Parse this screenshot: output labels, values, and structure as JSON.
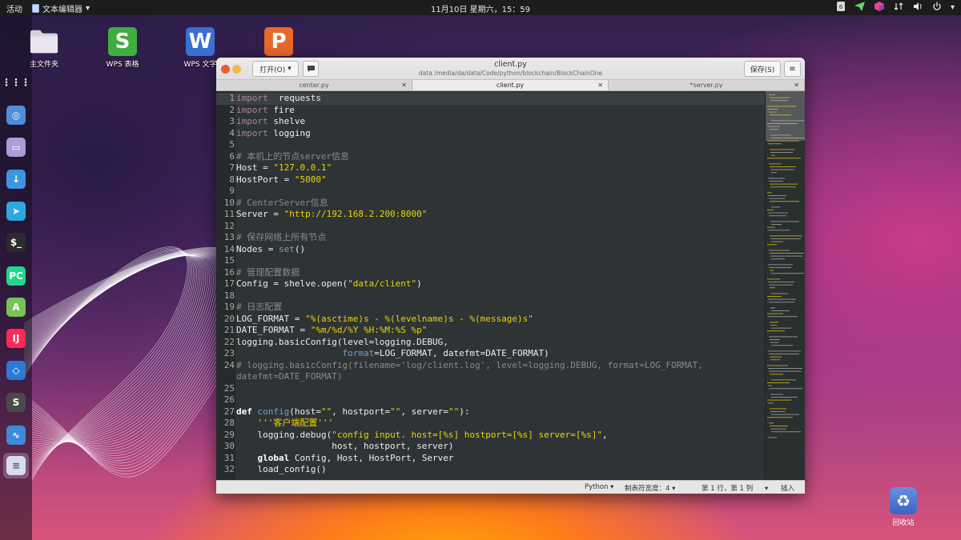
{
  "topbar": {
    "activities": "活动",
    "app_menu": "文本编辑器",
    "app_menu_arrow": "▾",
    "clock": "11月10日 星期六，15：59",
    "tray_icons": [
      "app-indicator-icon",
      "send-icon",
      "cube-icon",
      "network-icon",
      "volume-icon",
      "power-icon"
    ],
    "tray_arrow": "▾"
  },
  "desktop": {
    "icons": [
      {
        "label": "主文件夹",
        "icon": "folder-icon"
      },
      {
        "label": "WPS 表格",
        "icon": "wps-spreadsheet-icon",
        "glyph": "S",
        "color": "#3fae3f"
      },
      {
        "label": "WPS 文字",
        "icon": "wps-writer-icon",
        "glyph": "W",
        "color": "#3b6fd1"
      },
      {
        "label": "",
        "icon": "wps-presentation-icon",
        "glyph": "P",
        "color": "#e8682a"
      }
    ],
    "trash_label": "回收站"
  },
  "dock": {
    "items": [
      {
        "name": "app-grid",
        "glyph": "⋮⋮⋮",
        "color": "#ffffff"
      },
      {
        "name": "chromium",
        "glyph": "◎",
        "color": "#4a8fd8"
      },
      {
        "name": "files",
        "glyph": "▭",
        "color": "#b09ad8"
      },
      {
        "name": "downloader",
        "glyph": "↓",
        "color": "#3d95e0"
      },
      {
        "name": "telegram",
        "glyph": "➤",
        "color": "#2ea6df"
      },
      {
        "name": "terminal",
        "glyph": "$_",
        "color": "#2b2b2b"
      },
      {
        "name": "pycharm",
        "glyph": "PC",
        "color": "#21d789"
      },
      {
        "name": "android-studio",
        "glyph": "A",
        "color": "#78c257"
      },
      {
        "name": "intellij",
        "glyph": "IJ",
        "color": "#fe2857"
      },
      {
        "name": "vscode",
        "glyph": "◇",
        "color": "#2b7bd6"
      },
      {
        "name": "sublime",
        "glyph": "S",
        "color": "#4a4a4a"
      },
      {
        "name": "system-monitor",
        "glyph": "∿",
        "color": "#3d8bd9"
      },
      {
        "name": "text-editor",
        "glyph": "≡",
        "color": "#d8dcf0"
      }
    ]
  },
  "window": {
    "open_label": "打开(O)",
    "open_arrow": "▾",
    "title": "client.py",
    "path": "data /media/da/data/Code/python/blockchain/BlockChainOne",
    "save_label": "保存(S)",
    "menu_glyph": "≡",
    "tabs": [
      {
        "label": "center.py",
        "close": "✕",
        "active": false
      },
      {
        "label": "client.py",
        "close": "✕",
        "active": true
      },
      {
        "label": "*server.py",
        "close": "✕",
        "active": false
      }
    ],
    "code_lines": [
      {
        "n": "1",
        "tokens": [
          [
            "kw",
            "import"
          ],
          [
            "",
            "  requests"
          ]
        ]
      },
      {
        "n": "2",
        "tokens": [
          [
            "kw",
            "import"
          ],
          [
            "",
            " fire"
          ]
        ]
      },
      {
        "n": "3",
        "tokens": [
          [
            "kw",
            "import"
          ],
          [
            "",
            " shelve"
          ]
        ]
      },
      {
        "n": "4",
        "tokens": [
          [
            "kw",
            "import"
          ],
          [
            "",
            " logging"
          ]
        ]
      },
      {
        "n": "5",
        "tokens": []
      },
      {
        "n": "6",
        "tokens": [
          [
            "cmt",
            "# 本机上的节点server信息"
          ]
        ]
      },
      {
        "n": "7",
        "tokens": [
          [
            "",
            "Host = "
          ],
          [
            "str",
            "\"127.0.0.1\""
          ]
        ]
      },
      {
        "n": "8",
        "tokens": [
          [
            "",
            "HostPort = "
          ],
          [
            "str",
            "\"5000\""
          ]
        ]
      },
      {
        "n": "9",
        "tokens": []
      },
      {
        "n": "10",
        "tokens": [
          [
            "cmt",
            "# CenterServer信息"
          ]
        ]
      },
      {
        "n": "11",
        "tokens": [
          [
            "",
            "Server = "
          ],
          [
            "str",
            "\"http://192.168.2.200:8000\""
          ]
        ]
      },
      {
        "n": "12",
        "tokens": []
      },
      {
        "n": "13",
        "tokens": [
          [
            "cmt",
            "# 保存网络上所有节点"
          ]
        ]
      },
      {
        "n": "14",
        "tokens": [
          [
            "",
            "Nodes = "
          ],
          [
            "builtin",
            "set"
          ],
          [
            "",
            "()"
          ]
        ]
      },
      {
        "n": "15",
        "tokens": []
      },
      {
        "n": "16",
        "tokens": [
          [
            "cmt",
            "# 管理配置数据"
          ]
        ]
      },
      {
        "n": "17",
        "tokens": [
          [
            "",
            "Config = shelve.open("
          ],
          [
            "str",
            "\"data/client\""
          ],
          [
            "",
            ")"
          ]
        ]
      },
      {
        "n": "18",
        "tokens": []
      },
      {
        "n": "19",
        "tokens": [
          [
            "cmt",
            "# 日志配置"
          ]
        ]
      },
      {
        "n": "20",
        "tokens": [
          [
            "",
            "LOG_FORMAT = "
          ],
          [
            "str",
            "\"%(asctime)s - %(levelname)s - %(message)s\""
          ]
        ]
      },
      {
        "n": "21",
        "tokens": [
          [
            "",
            "DATE_FORMAT = "
          ],
          [
            "str",
            "\"%m/%d/%Y %H:%M:%S %p\""
          ]
        ]
      },
      {
        "n": "22",
        "tokens": [
          [
            "",
            "logging.basicConfig(level=logging.DEBUG,"
          ]
        ]
      },
      {
        "n": "23",
        "tokens": [
          [
            "",
            "                    "
          ],
          [
            "builtin",
            "format"
          ],
          [
            "",
            "=LOG_FORMAT, datefmt=DATE_FORMAT)"
          ]
        ]
      },
      {
        "n": "24",
        "tokens": [
          [
            "cmt",
            "# logging.basicConfig(filename='log/client.log', level=logging.DEBUG, format=LOG_FORMAT,"
          ]
        ]
      },
      {
        "n": "",
        "tokens": [
          [
            "cmt",
            "datefmt=DATE_FORMAT)"
          ]
        ]
      },
      {
        "n": "25",
        "tokens": []
      },
      {
        "n": "26",
        "tokens": []
      },
      {
        "n": "27",
        "tokens": [
          [
            "kwb",
            "def"
          ],
          [
            "",
            " "
          ],
          [
            "fn",
            "config"
          ],
          [
            "",
            "(host="
          ],
          [
            "str",
            "\"\""
          ],
          [
            "",
            ", hostport="
          ],
          [
            "str",
            "\"\""
          ],
          [
            "",
            ", server="
          ],
          [
            "str",
            "\"\""
          ],
          [
            "",
            "):"
          ]
        ]
      },
      {
        "n": "28",
        "tokens": [
          [
            "",
            "    "
          ],
          [
            "str",
            "'''客户端配置'''"
          ]
        ]
      },
      {
        "n": "29",
        "tokens": [
          [
            "",
            "    logging.debug("
          ],
          [
            "str",
            "\"config input. host=[%s] hostport=[%s] server=[%s]\""
          ],
          [
            "",
            ","
          ]
        ]
      },
      {
        "n": "30",
        "tokens": [
          [
            "",
            "                  host, hostport, server)"
          ]
        ]
      },
      {
        "n": "31",
        "tokens": [
          [
            "",
            "    "
          ],
          [
            "kwb",
            "global"
          ],
          [
            "",
            " Config, Host, HostPort, Server"
          ]
        ]
      },
      {
        "n": "32",
        "tokens": [
          [
            "",
            "    load_config()"
          ]
        ]
      }
    ],
    "statusbar": {
      "language": "Python",
      "tab_width": "制表符宽度：4",
      "position": "第 1 行，第 1 列",
      "mode": "插入",
      "arrow": "▾"
    }
  }
}
